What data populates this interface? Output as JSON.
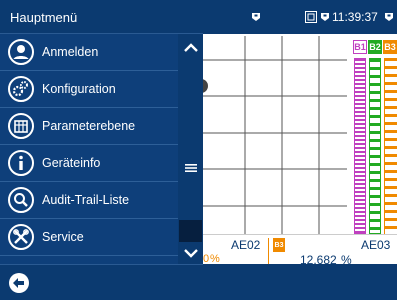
{
  "menu": {
    "title": "Hauptmenü",
    "items": [
      {
        "label": "Anmelden",
        "icon": "user-icon"
      },
      {
        "label": "Konfiguration",
        "icon": "gears-icon"
      },
      {
        "label": "Parameterebene",
        "icon": "parameter-icon"
      },
      {
        "label": "Geräteinfo",
        "icon": "info-icon"
      },
      {
        "label": "Audit-Trail-Liste",
        "icon": "audit-magnifier-icon"
      },
      {
        "label": "Service",
        "icon": "service-tools-icon"
      }
    ]
  },
  "status": {
    "time": "11:39:37"
  },
  "channels": {
    "tags": [
      "B1",
      "B2",
      "B3"
    ],
    "ae02_label": "AE02",
    "ae02_value": "0",
    "ae02_unit": "%",
    "ae03_label": "AE03",
    "ae03_value": "12.682",
    "ae03_unit": "%"
  },
  "colors": {
    "menu_bg": "#0e3f7a",
    "header_bg": "#0b3a70",
    "b1": "#c040c0",
    "b2": "#22aa22",
    "b3": "#f08a00"
  }
}
